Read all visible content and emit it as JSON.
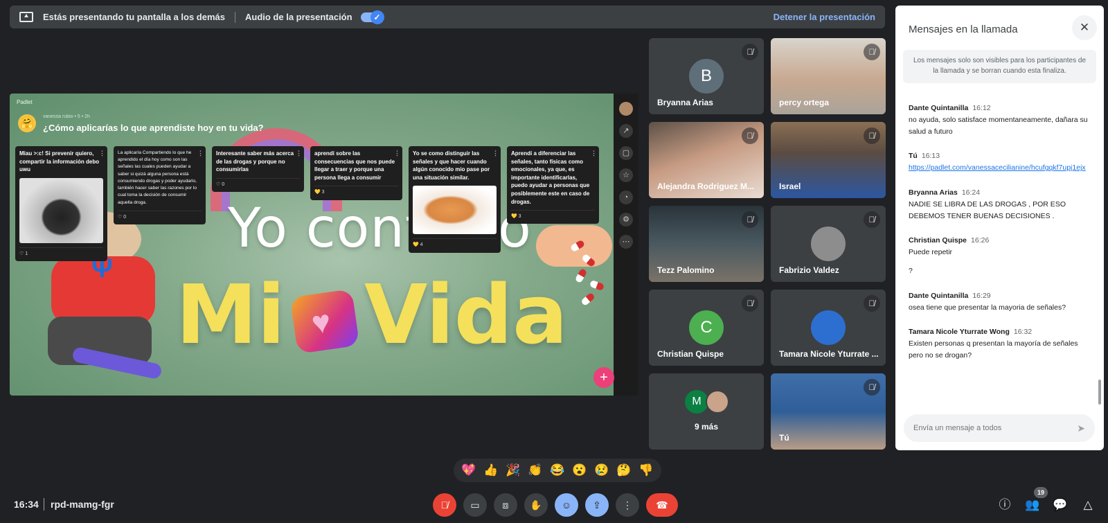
{
  "present_bar": {
    "message": "Estás presentando tu pantalla a los demás",
    "audio_label": "Audio de la presentación",
    "stop_label": "Detener la presentación"
  },
  "slide": {
    "brand": "Padlet",
    "author": "vanessa rubio • 5 • 2h",
    "question": "¿Cómo aplicarías lo que aprendiste hoy en tu vida?",
    "headline_top": "Yo controlo",
    "headline_left": "Mi",
    "headline_right": "Vida",
    "add_label": "+",
    "cards": [
      {
        "text": "Miau >:c! Si prevenir quiero, compartir la información debo uwu",
        "likes": "1"
      },
      {
        "text": "La aplicaría Compartiendo lo que he aprendido el día hoy como son las señales las cuales pueden ayudar a saber si quizá alguna persona está consumiendo drogas y poder ayudarlo, también hacer saber las razones por lo cual toma la decisión de consumir aquella droga.",
        "likes": "0"
      },
      {
        "text": "Interesante saber más acerca de las drogas y porque no consumirlas",
        "likes": "0"
      },
      {
        "text": "aprendí sobre las consecuencias que nos puede llegar a traer y porque una persona llega a consumir",
        "likes": "3"
      },
      {
        "text": "Yo se como distinguir las señales y que hacer cuando algún conocido mio pase por una situación similar.",
        "likes": "4"
      },
      {
        "text": "Aprendí a diferenciar las señales, tanto físicas como emocionales, ya que, es importante identificarlas, puedo ayudar a personas que posiblemente este en caso de drogas.",
        "likes": "3"
      }
    ]
  },
  "participants": [
    {
      "name": "Bryanna Arias",
      "initial": "B",
      "avatar_color": "#5f6f7a"
    },
    {
      "name": "percy ortega"
    },
    {
      "name": "Alejandra Rodriguez M..."
    },
    {
      "name": "Israel"
    },
    {
      "name": "Tezz Palomino"
    },
    {
      "name": "Fabrizio Valdez"
    },
    {
      "name": "Christian Quispe",
      "initial": "C",
      "avatar_color": "#4caf50"
    },
    {
      "name": "Tamara Nicole Yturrate ..."
    },
    {
      "name": "9 más",
      "initial": "M",
      "avatar_color": "#0b8043"
    },
    {
      "name": "Tú"
    }
  ],
  "chat": {
    "title": "Mensajes en la llamada",
    "notice": "Los mensajes solo son visibles para los participantes de la llamada y se borran cuando esta finaliza.",
    "placeholder": "Envía un mensaje a todos",
    "messages": [
      {
        "sender": "Dante Quintanilla",
        "time": "16:12",
        "body": "no ayuda, solo satisface momentaneamente, dañara su salud a futuro"
      },
      {
        "sender": "Tú",
        "time": "16:13",
        "link": "https://padlet.com/vanessacecilianine/hcufgqkf7upj1ejx"
      },
      {
        "sender": "Bryanna Arias",
        "time": "16:24",
        "body": "NADIE SE  LIBRA DE LAS DROGAS , POR ESO DEBEMOS TENER  BUENAS DECISIONES ."
      },
      {
        "sender": "Christian Quispe",
        "time": "16:26",
        "body": "Puede repetir",
        "body2": "?"
      },
      {
        "sender": "Dante Quintanilla",
        "time": "16:29",
        "body": "osea tiene que presentar la mayoria de señales?"
      },
      {
        "sender": "Tamara Nicole Yturrate Wong",
        "time": "16:32",
        "body": "Existen personas q presentan la mayoría de señales pero no se drogan?"
      }
    ]
  },
  "reactions": [
    "💖",
    "👍",
    "🎉",
    "👏",
    "😂",
    "😮",
    "😢",
    "🤔",
    "👎"
  ],
  "bottom": {
    "time": "16:34",
    "meeting_code": "rpd-mamg-fgr",
    "participant_count": "19"
  },
  "colors": {
    "end_call": "#ea4335",
    "accent": "#8ab4f8",
    "tile_bg": "#3c4043"
  }
}
